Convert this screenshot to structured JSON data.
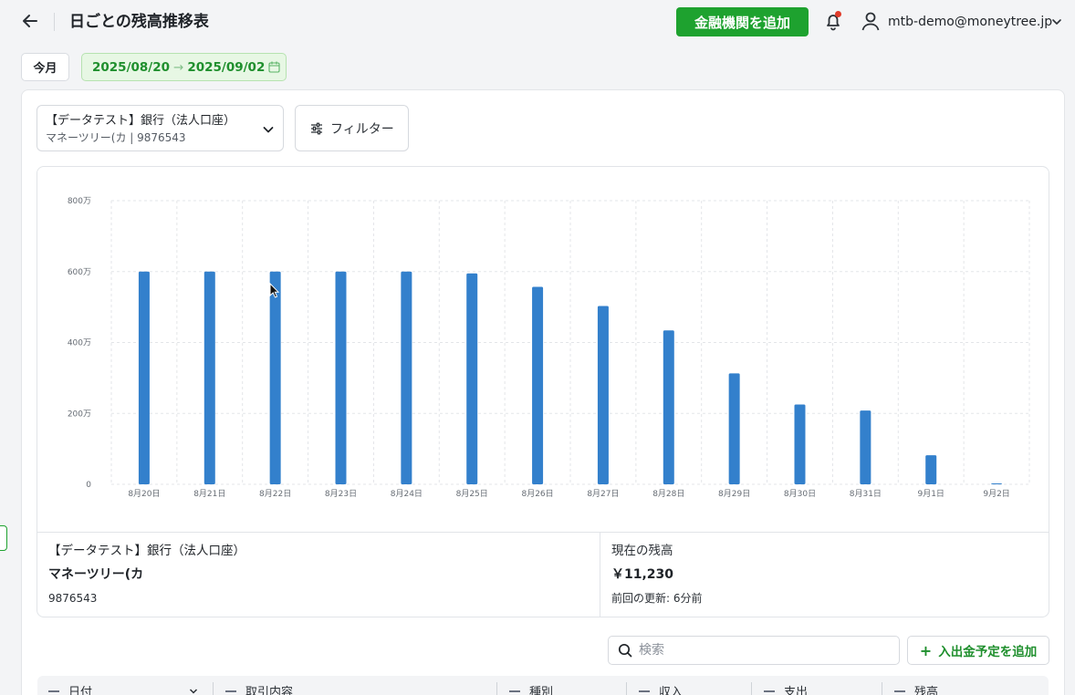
{
  "header": {
    "title": "日ごとの残高推移表",
    "add_institution_label": "金融機関を追加",
    "user_email": "mtb-demo@moneytree.jp"
  },
  "date_filter": {
    "today_label": "今月",
    "start": "2025/08/20",
    "arrow": "→",
    "end": "2025/09/02"
  },
  "account_select": {
    "name": "【データテスト】銀行（法人口座）",
    "sub": "マネーツリー(カ | 9876543"
  },
  "filter_label": "フィルター",
  "chart_data": {
    "type": "bar",
    "title": "",
    "xlabel": "",
    "ylabel": "",
    "categories": [
      "8月20日",
      "8月21日",
      "8月22日",
      "8月23日",
      "8月24日",
      "8月25日",
      "8月26日",
      "8月27日",
      "8月28日",
      "8月29日",
      "8月30日",
      "8月31日",
      "9月1日",
      "9月2日"
    ],
    "values": [
      6000000,
      6000000,
      6000000,
      6000000,
      6000000,
      5950000,
      5570000,
      5030000,
      4340000,
      3130000,
      2250000,
      2080000,
      820000,
      11230
    ],
    "ylim": [
      0,
      8000000
    ],
    "yticks": [
      {
        "value": 0,
        "label": "0"
      },
      {
        "value": 2000000,
        "label": "200万"
      },
      {
        "value": 4000000,
        "label": "400万"
      },
      {
        "value": 6000000,
        "label": "600万"
      },
      {
        "value": 8000000,
        "label": "800万"
      }
    ],
    "grid": true,
    "bar_color": "#3380cc"
  },
  "account_info": {
    "bank": "【データテスト】銀行（法人口座）",
    "holder": "マネーツリー(カ",
    "number": "9876543"
  },
  "balance": {
    "label": "現在の残高",
    "value": "￥11,230",
    "updated": "前回の更新: 6分前"
  },
  "search": {
    "placeholder": "検索"
  },
  "add_plan_label": "入出金予定を追加",
  "table": {
    "columns": [
      "日付",
      "取引内容",
      "種別",
      "収入",
      "支出",
      "残高"
    ]
  },
  "colors": {
    "accent": "#1ea22f",
    "bar": "#3380cc",
    "notification_dot": "#e03b2a"
  }
}
